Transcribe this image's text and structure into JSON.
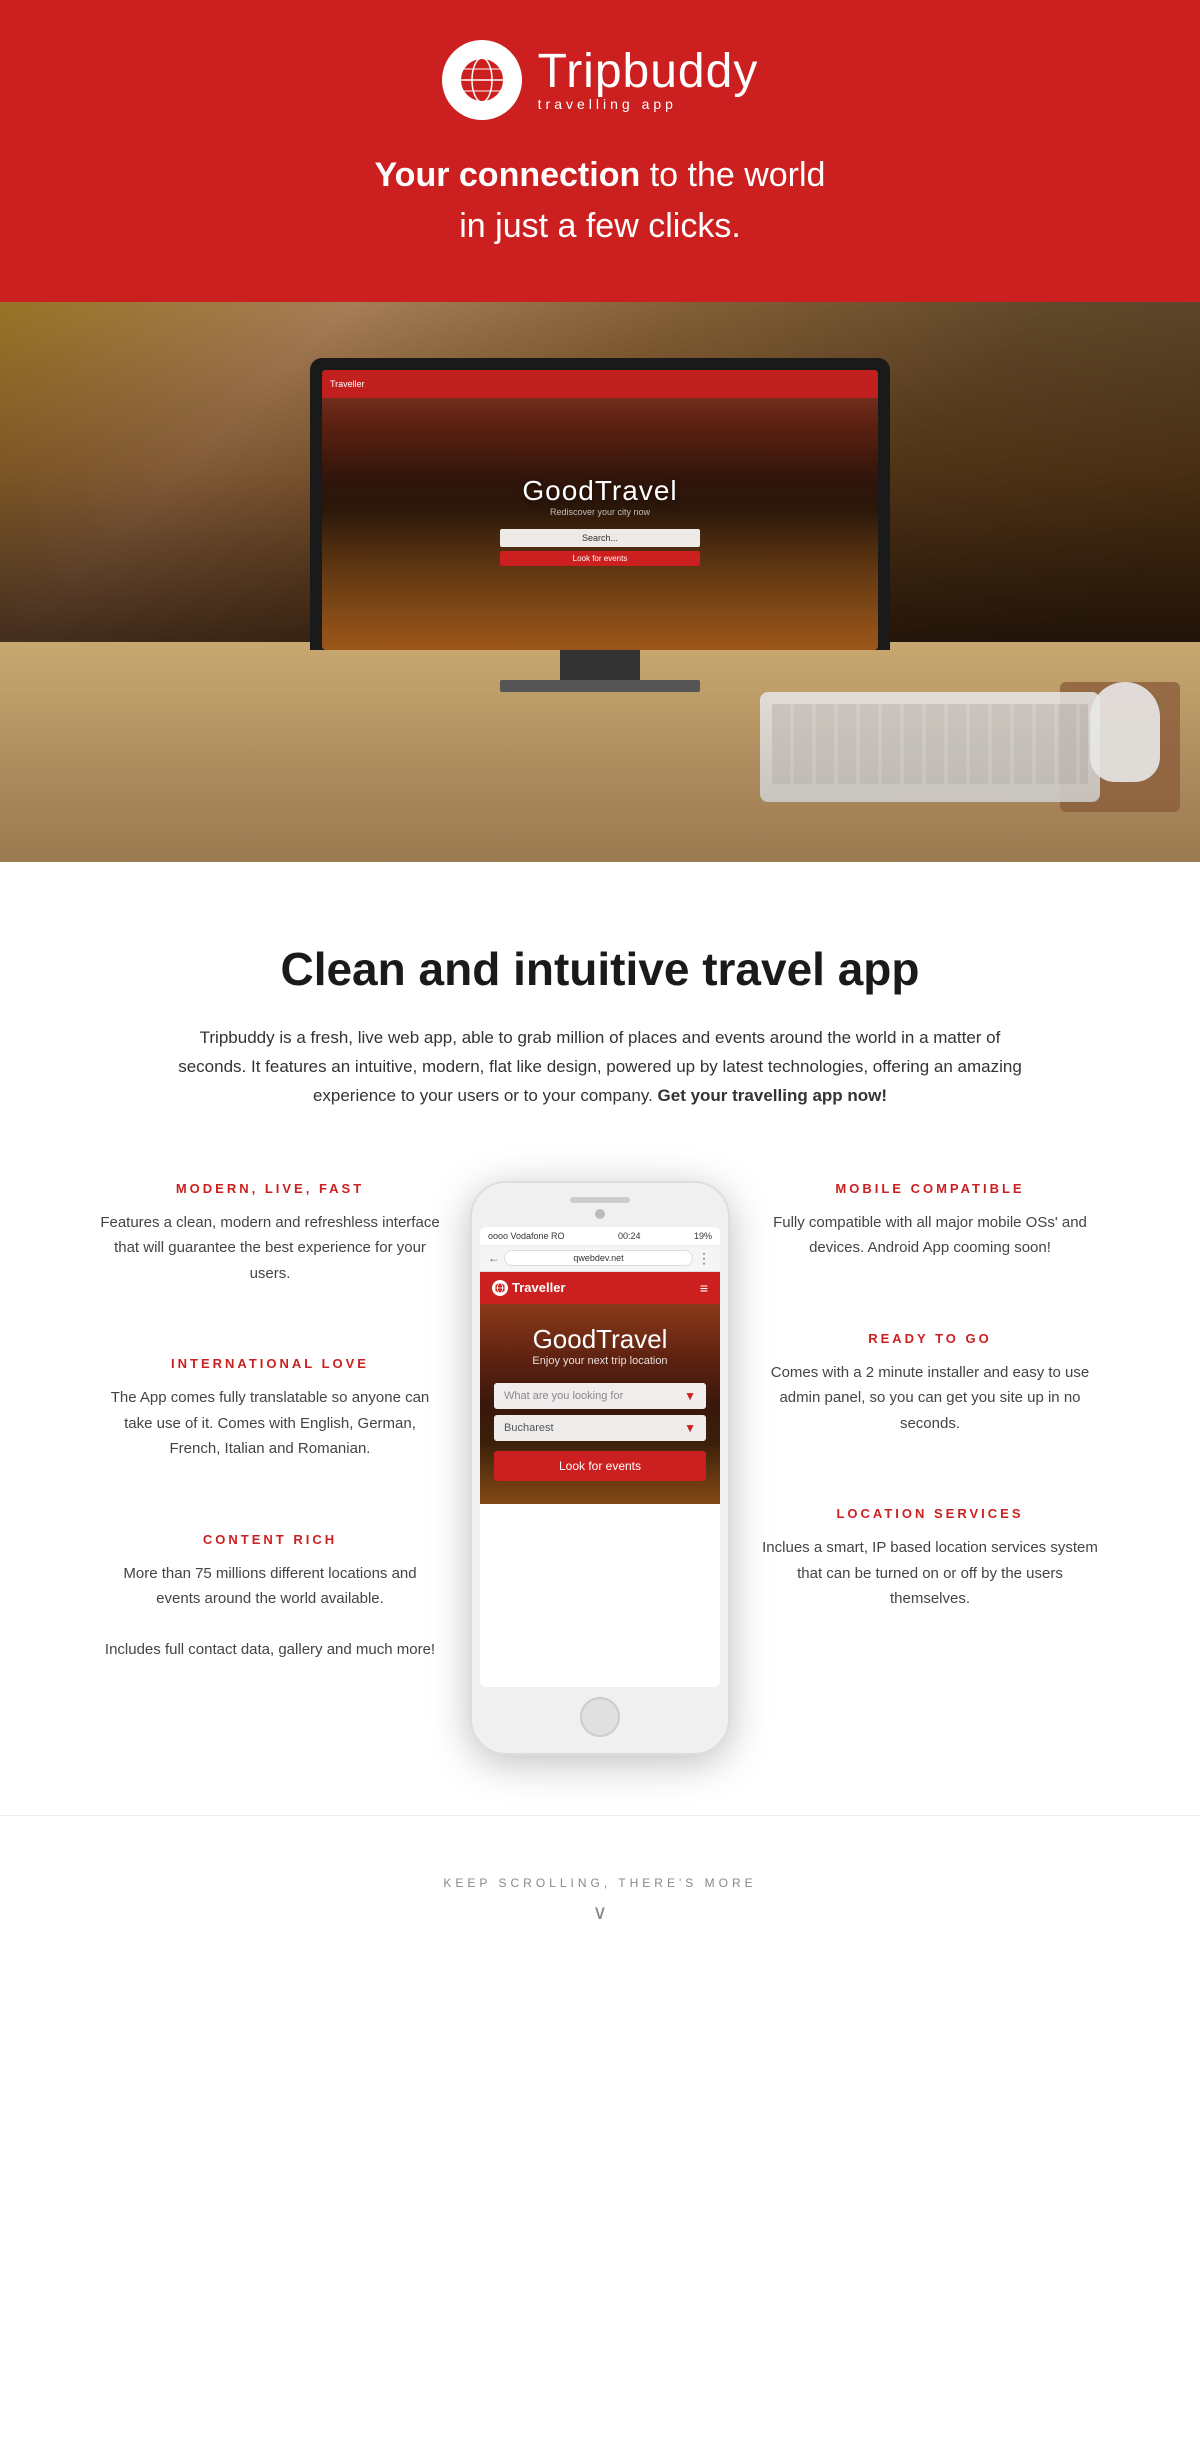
{
  "header": {
    "logo_brand": "Tripbuddy",
    "logo_sub": "travelling app",
    "tagline_bold": "Your connection",
    "tagline_rest": " to the world",
    "tagline_line2": "in just a few clicks."
  },
  "features_section": {
    "title": "Clean and intuitive travel app",
    "description_1": "Tripbuddy is a  fresh, live web app,  able to grab million of places and events around the world in a matter of seconds. It features an intuitive, modern, flat like design, powered up by latest technologies, offering an amazing experience to your users or to your company. ",
    "description_bold": "Get your travelling app now!"
  },
  "left_features": [
    {
      "title": "MODERN, LIVE, FAST",
      "desc": "Features a clean, modern and refreshless interface that will guarantee the best experience for your users."
    },
    {
      "title": "INTERNATIONAL LOVE",
      "desc": "The App comes fully translatable so anyone can take use of it. Comes with English, German, French, Italian and Romanian."
    },
    {
      "title": "CONTENT RICH",
      "desc": "More than 75 millions different locations and events around the world  available.\n\nIncludes full contact data, gallery and much more!"
    }
  ],
  "right_features": [
    {
      "title": "MOBILE COMPATIBLE",
      "desc": "Fully compatible with all major mobile OSs' and devices. Android App cooming soon!"
    },
    {
      "title": "READY TO GO",
      "desc": "Comes with a 2 minute installer and easy to use admin panel, so you can get you site up in no seconds."
    },
    {
      "title": "LOCATION SERVICES",
      "desc": "Inclues a smart, IP based location services system that can be turned on or off by the users themselves."
    }
  ],
  "phone": {
    "status_left": "oooo Vodafone RO",
    "status_time": "00:24",
    "status_right": "19%",
    "browser_url": "qwebdev.net",
    "nav_label": "Traveller",
    "app_title": "GoodTravel",
    "app_subtitle": "Enjoy your next trip location",
    "search_placeholder": "What are you looking for",
    "location_value": "Bucharest",
    "search_btn": "Look for events"
  },
  "screen": {
    "nav_label": "Traveller",
    "title": "GoodTravel",
    "subtitle": "Rediscover your city now"
  },
  "footer": {
    "keep_scrolling": "KEEP SCROLLING, THERE'S MORE"
  },
  "colors": {
    "brand_red": "#cc1f1f",
    "dark": "#1a1a1a",
    "text": "#333"
  }
}
